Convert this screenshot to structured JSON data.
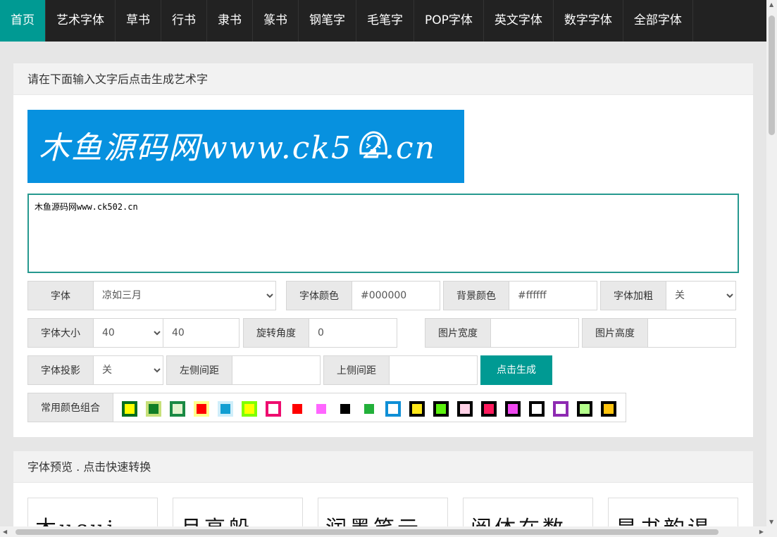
{
  "nav": {
    "items": [
      "首页",
      "艺术字体",
      "草书",
      "行书",
      "隶书",
      "篆书",
      "钢笔字",
      "毛笔字",
      "POP字体",
      "英文字体",
      "数字字体",
      "全部字体"
    ],
    "active_index": 0
  },
  "generator": {
    "header": "请在下面输入文字后点击生成艺术字",
    "banner_text": "木鱼源码网www.ck5  2.cn",
    "banner_bg": "#0791df",
    "text_value": "木鱼源码网www.ck502.cn",
    "font_label": "字体",
    "font_value": "凉如三月",
    "font_color_label": "字体颜色",
    "font_color_value": "#000000",
    "bg_color_label": "背景颜色",
    "bg_color_value": "#ffffff",
    "bold_label": "字体加粗",
    "bold_value": "关",
    "size_label": "字体大小",
    "size_select_value": "40",
    "size_input_value": "40",
    "rotate_label": "旋转角度",
    "rotate_value": "0",
    "width_label": "图片宽度",
    "width_value": "",
    "height_label": "图片高度",
    "height_value": "",
    "shadow_label": "字体投影",
    "shadow_value": "关",
    "left_margin_label": "左侧间距",
    "left_margin_value": "",
    "top_margin_label": "上侧间距",
    "top_margin_value": "",
    "generate_button": "点击生成",
    "accent_color": "#009a93",
    "color_combos_label": "常用颜色组合",
    "color_combos": [
      {
        "border": "#006f1d",
        "fill": "#ffff00"
      },
      {
        "border": "#c7e07a",
        "fill": "#117e26"
      },
      {
        "border": "#1a8a44",
        "fill": "#e3f3cf"
      },
      {
        "border": "#ffff8a",
        "fill": "#ff0000"
      },
      {
        "border": "#cfeefa",
        "fill": "#119ed2"
      },
      {
        "border": "#80ff00",
        "fill": "#ffff00"
      },
      {
        "border": "#ee0d6f",
        "fill": "#ffffff"
      },
      {
        "border": "#ffffff",
        "fill": "#ff0000"
      },
      {
        "border": "#ffffff",
        "fill": "#ff66ff"
      },
      {
        "border": "#ffffff",
        "fill": "#000000"
      },
      {
        "border": "#ffffff",
        "fill": "#22b03a"
      },
      {
        "border": "#0f8fd6",
        "fill": "#ffffff"
      },
      {
        "border": "#000000",
        "fill": "#ffe81a"
      },
      {
        "border": "#000000",
        "fill": "#5cf20f"
      },
      {
        "border": "#000000",
        "fill": "#ffd1e6"
      },
      {
        "border": "#000000",
        "fill": "#ff1b5e"
      },
      {
        "border": "#000000",
        "fill": "#ef48ef"
      },
      {
        "border": "#000000",
        "fill": "#ffffff"
      },
      {
        "border": "#8e2ab2",
        "fill": "#ffffff"
      },
      {
        "border": "#000000",
        "fill": "#b4ff8b"
      },
      {
        "border": "#000000",
        "fill": "#ffc40f"
      }
    ]
  },
  "preview": {
    "header": "字体预览 . 点击快速转换",
    "cards": [
      "木ucui",
      "月高船",
      "润墨笑云",
      "阅体在数",
      "是书韵谒"
    ]
  }
}
